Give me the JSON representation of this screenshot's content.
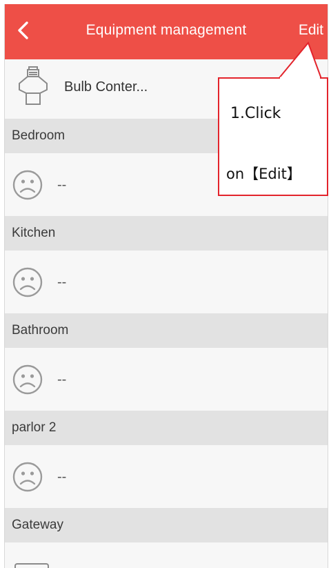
{
  "header": {
    "back_icon": "chevron-left-icon",
    "title": "Equipment management",
    "edit_label": "Edit",
    "bar_color": "#ee4f47"
  },
  "device": {
    "icon": "bulb-icon",
    "label": "Bulb Conter..."
  },
  "sections": [
    {
      "title": "Bedroom",
      "empty_label": "--",
      "empty_icon": "sad-face-icon"
    },
    {
      "title": "Kitchen",
      "empty_label": "--",
      "empty_icon": "sad-face-icon"
    },
    {
      "title": "Bathroom",
      "empty_label": "--",
      "empty_icon": "sad-face-icon"
    },
    {
      "title": "parlor 2",
      "empty_label": "--",
      "empty_icon": "sad-face-icon"
    },
    {
      "title": "Gateway"
    }
  ],
  "annotation": {
    "line1": "1.Click",
    "line2": "on【Edit】",
    "border_color": "#e3232b"
  }
}
